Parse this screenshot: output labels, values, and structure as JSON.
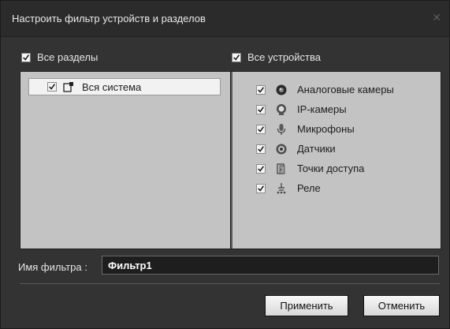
{
  "dialog": {
    "title": "Настроить фильтр устройств и разделов",
    "close_icon": "close-icon"
  },
  "sections": {
    "all_label": "Все разделы",
    "all_checked": true,
    "items": [
      {
        "label": "Вся система",
        "icon": "system-icon",
        "checked": true
      }
    ]
  },
  "devices": {
    "all_label": "Все устройства",
    "all_checked": true,
    "items": [
      {
        "label": "Аналоговые камеры",
        "icon": "analog-camera-icon",
        "checked": true
      },
      {
        "label": "IP-камеры",
        "icon": "ip-camera-icon",
        "checked": true
      },
      {
        "label": "Микрофоны",
        "icon": "microphone-icon",
        "checked": true
      },
      {
        "label": "Датчики",
        "icon": "sensor-icon",
        "checked": true
      },
      {
        "label": "Точки доступа",
        "icon": "access-point-icon",
        "checked": true
      },
      {
        "label": "Реле",
        "icon": "relay-icon",
        "checked": true
      }
    ]
  },
  "filter": {
    "label": "Имя фильтра :",
    "value": "Фильтр1"
  },
  "buttons": {
    "apply": "Применить",
    "cancel": "Отменить"
  },
  "colors": {
    "dialog_bg": "#333333",
    "panel_bg": "#c3c3c3",
    "input_bg": "#1e1e1e"
  }
}
